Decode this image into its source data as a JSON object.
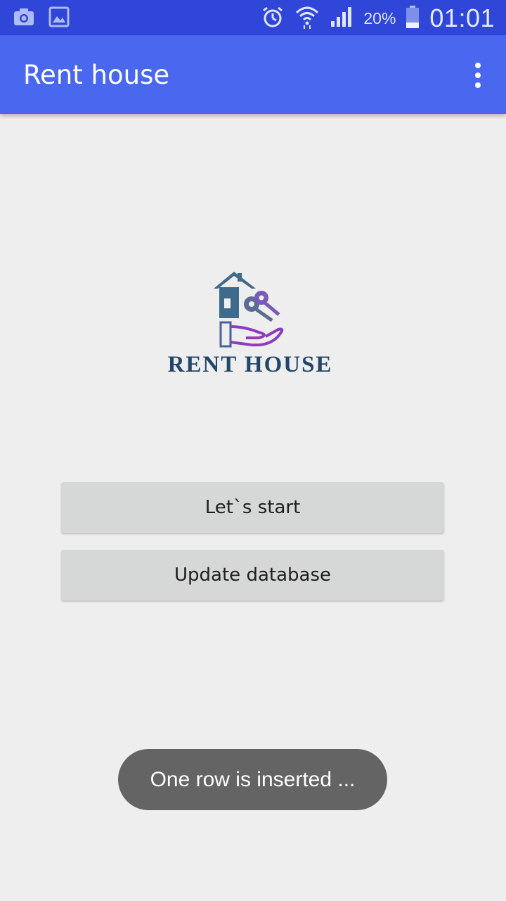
{
  "status_bar": {
    "left_icons": [
      "camera-icon",
      "gallery-icon"
    ],
    "right_icons": [
      "alarm-icon",
      "wifi-icon",
      "signal-icon",
      "battery-icon"
    ],
    "battery_percent": "20%",
    "time": "01:01"
  },
  "app_bar": {
    "title": "Rent house",
    "menu_icon": "more-vert-icon"
  },
  "logo": {
    "text": "RENT HOUSE",
    "colors": {
      "house": "#3f6a8c",
      "keys": "#6a4fa8",
      "hand": "#8e3bbd",
      "text": "#23476a"
    }
  },
  "buttons": {
    "start_label": "Let`s start",
    "update_label": "Update database"
  },
  "toast": {
    "message": "One row is inserted ..."
  },
  "colors": {
    "status_bar": "#2f46d9",
    "app_bar": "#4a67ef",
    "background": "#eeeeee",
    "button": "#d6d7d7",
    "toast": "#646464"
  }
}
